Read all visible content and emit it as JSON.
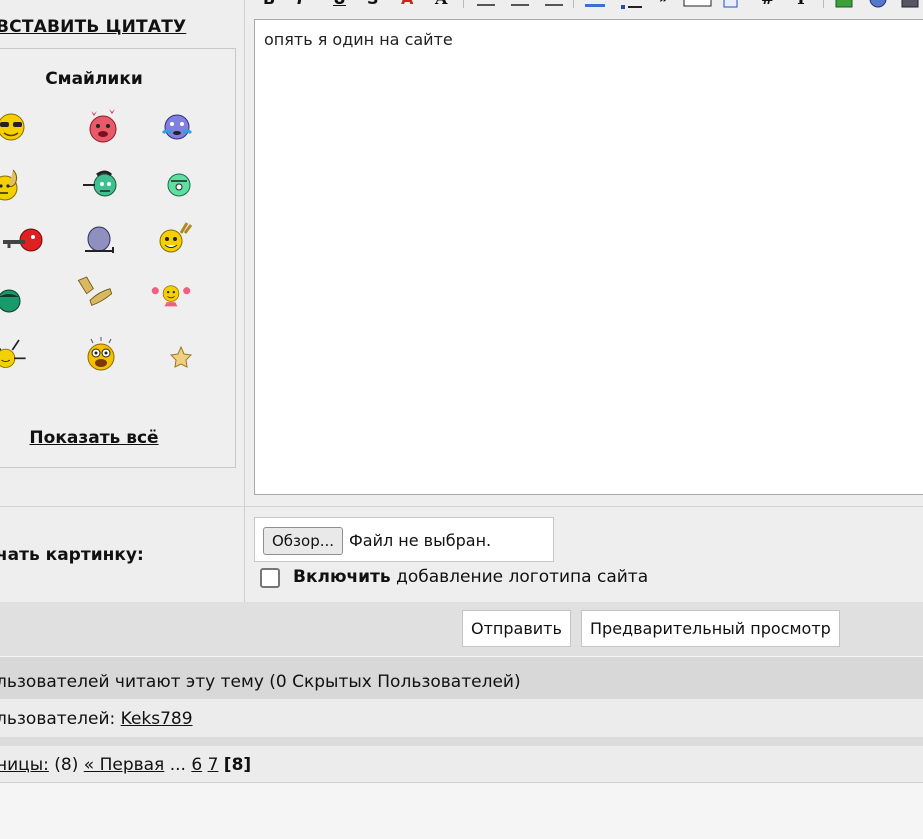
{
  "insert_quote": "ВСТАВИТЬ ЦИТАТУ",
  "smilies": {
    "title": "Смайлики",
    "show_all": "Показать всё",
    "icons": [
      "cool-smiley-icon",
      "in-love-smiley-icon",
      "crying-smiley-icon",
      "thinking-smiley-icon",
      "zombie-smiley-icon",
      "green-smiley-icon",
      "gun-smiley-icon",
      "sad-sitting-smiley-icon",
      "rock-smiley-icon",
      "green-dark-smiley-icon",
      "clapping-hands-icon",
      "cheerleader-smiley-icon",
      "hanging-smiley-icon",
      "shocked-smiley-icon",
      "star-icon"
    ]
  },
  "editor": {
    "text": "опять я один на сайте"
  },
  "attach": {
    "label": "чать картинку:",
    "browse": "Обзор...",
    "no_file": "Файл не выбран.",
    "logo_bold": "Включить",
    "logo_rest": " добавление логотипа сайта"
  },
  "buttons": {
    "send": "Отправить",
    "preview": "Предварительный просмотр"
  },
  "readers": {
    "text": "льзователей читают эту тему (0 Скрытых Пользователей)",
    "users_prefix": "льзователей: ",
    "user": "Keks789"
  },
  "pages": {
    "label": "ницы:",
    "count": " (8) ",
    "first": "« Первая",
    "ellipsis": " ... ",
    "p6": "6",
    "p7": "7",
    "current": "[8]"
  },
  "toolbar": {
    "bold": "B",
    "italic": "I",
    "underline": "U",
    "strike": "S",
    "color": "A",
    "font": "A",
    "hash": "#",
    "text": "T",
    "quote": "»"
  },
  "colors": {
    "accent_red": "#d02020",
    "smiley_yellow": "#f5d000"
  }
}
